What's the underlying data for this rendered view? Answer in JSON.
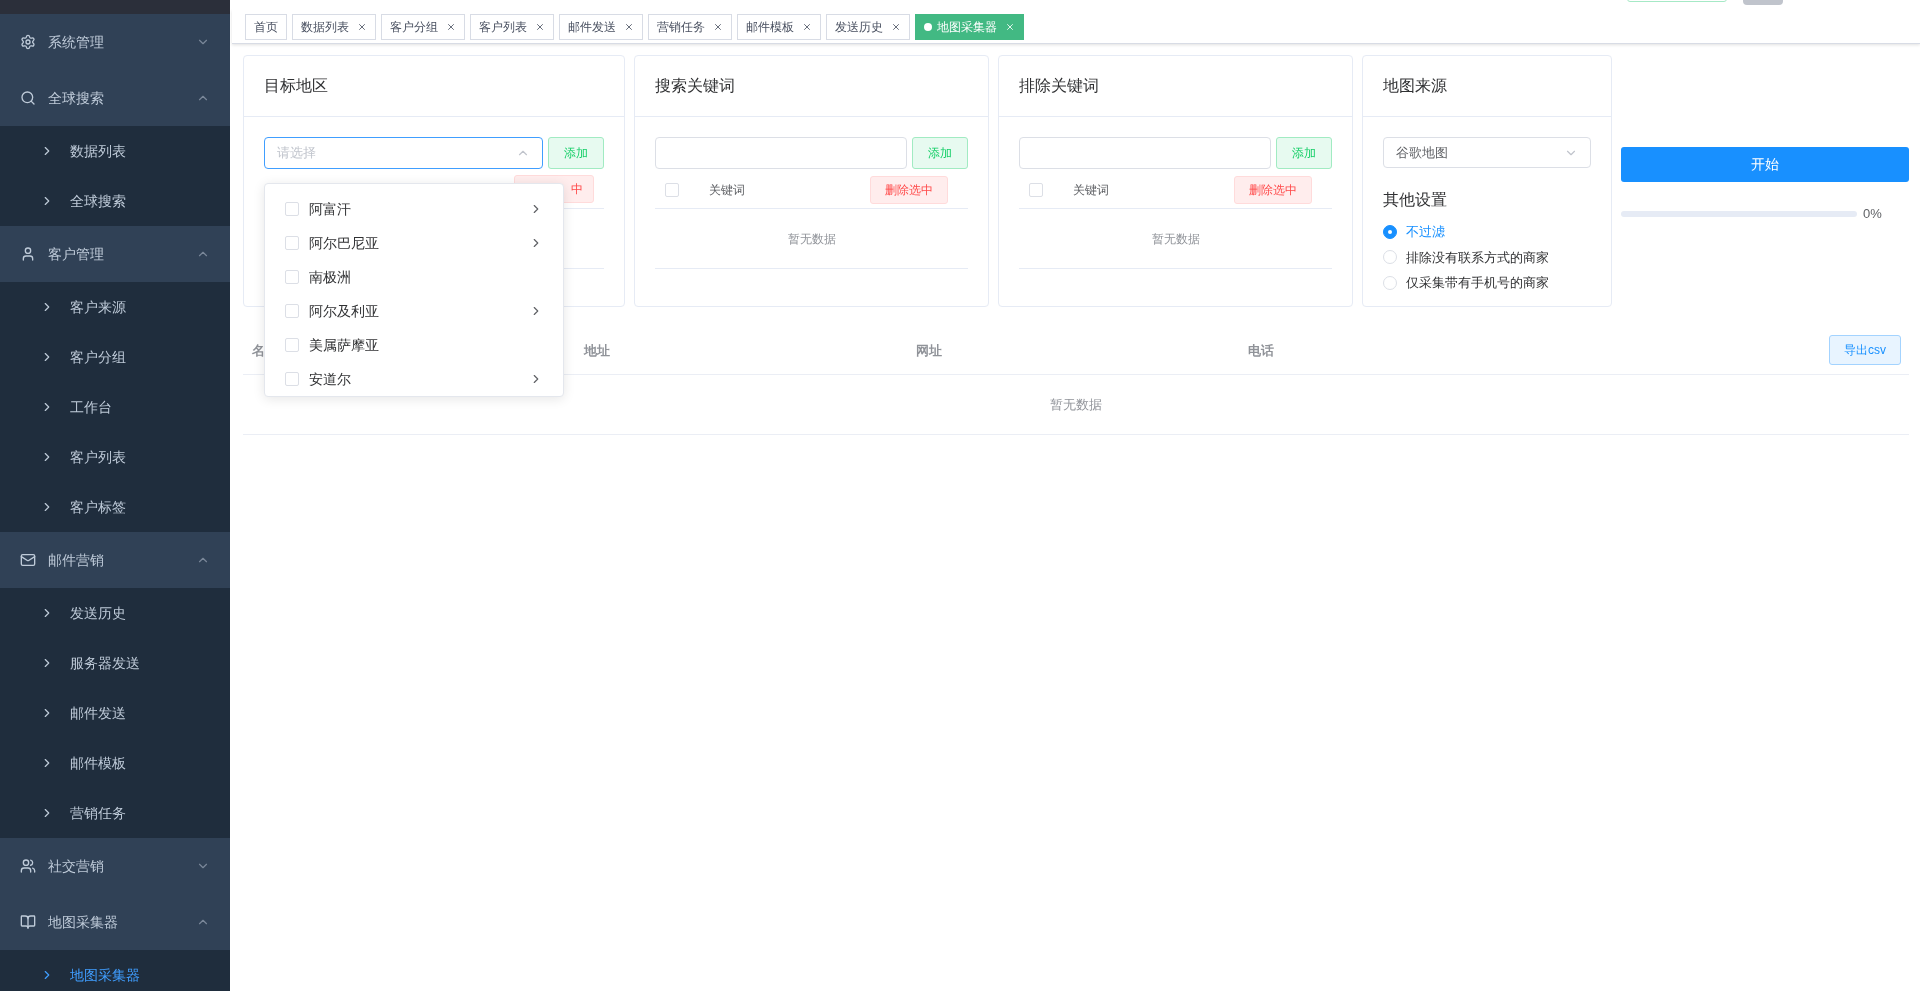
{
  "sidebar": {
    "groups": [
      {
        "label": "系统管理",
        "expanded": false
      },
      {
        "label": "全球搜索",
        "expanded": true,
        "children": [
          {
            "label": "数据列表",
            "selected": false
          },
          {
            "label": "全球搜索",
            "selected": false
          }
        ]
      },
      {
        "label": "客户管理",
        "expanded": true,
        "children": [
          {
            "label": "客户来源",
            "selected": false
          },
          {
            "label": "客户分组",
            "selected": false
          },
          {
            "label": "工作台",
            "selected": false
          },
          {
            "label": "客户列表",
            "selected": false
          },
          {
            "label": "客户标签",
            "selected": false
          }
        ]
      },
      {
        "label": "邮件营销",
        "expanded": true,
        "children": [
          {
            "label": "发送历史",
            "selected": false
          },
          {
            "label": "服务器发送",
            "selected": false
          },
          {
            "label": "邮件发送",
            "selected": false
          },
          {
            "label": "邮件模板",
            "selected": false
          },
          {
            "label": "营销任务",
            "selected": false
          }
        ]
      },
      {
        "label": "社交营销",
        "expanded": false
      },
      {
        "label": "地图采集器",
        "expanded": true,
        "children": [
          {
            "label": "地图采集器",
            "selected": true
          }
        ]
      }
    ]
  },
  "tabs": [
    {
      "label": "首页",
      "selected": false,
      "closable": false
    },
    {
      "label": "数据列表",
      "selected": false,
      "closable": true
    },
    {
      "label": "客户分组",
      "selected": false,
      "closable": true
    },
    {
      "label": "客户列表",
      "selected": false,
      "closable": true
    },
    {
      "label": "邮件发送",
      "selected": false,
      "closable": true
    },
    {
      "label": "营销任务",
      "selected": false,
      "closable": true
    },
    {
      "label": "邮件模板",
      "selected": false,
      "closable": true
    },
    {
      "label": "发送历史",
      "selected": false,
      "closable": true
    },
    {
      "label": "地图采集器",
      "selected": true,
      "closable": true
    }
  ],
  "target_region": {
    "title": "目标地区",
    "select": {
      "placeholder": "请选择",
      "open": true
    },
    "add_button": "添加",
    "delete_button": "中",
    "dropdown": [
      {
        "label": "阿富汗",
        "checked": false,
        "has_children": true
      },
      {
        "label": "阿尔巴尼亚",
        "checked": false,
        "has_children": true
      },
      {
        "label": "南极洲",
        "checked": false,
        "has_children": false
      },
      {
        "label": "阿尔及利亚",
        "checked": false,
        "has_children": true
      },
      {
        "label": "美属萨摩亚",
        "checked": false,
        "has_children": false
      },
      {
        "label": "安道尔",
        "checked": false,
        "has_children": true
      }
    ]
  },
  "keyword_panels": [
    {
      "title": "搜索关键词",
      "add_button": "添加",
      "header_checked": false,
      "column": "关键词",
      "delete_button": "删除选中",
      "empty": "暂无数据"
    },
    {
      "title": "排除关键词",
      "add_button": "添加",
      "header_checked": false,
      "column": "关键词",
      "delete_button": "删除选中",
      "empty": "暂无数据"
    }
  ],
  "map_source": {
    "title": "地图来源",
    "value": "谷歌地图",
    "settings_title": "其他设置",
    "options": [
      {
        "label": "不过滤",
        "selected": true
      },
      {
        "label": "排除没有联系方式的商家",
        "selected": false
      },
      {
        "label": "仅采集带有手机号的商家",
        "selected": false
      }
    ]
  },
  "start_button": "开始",
  "progress": {
    "level": 0,
    "reading": "0%"
  },
  "results": {
    "columns": [
      "名",
      "地址",
      "网址",
      "电话"
    ],
    "export_button": "导出csv",
    "empty": "暂无数据"
  }
}
